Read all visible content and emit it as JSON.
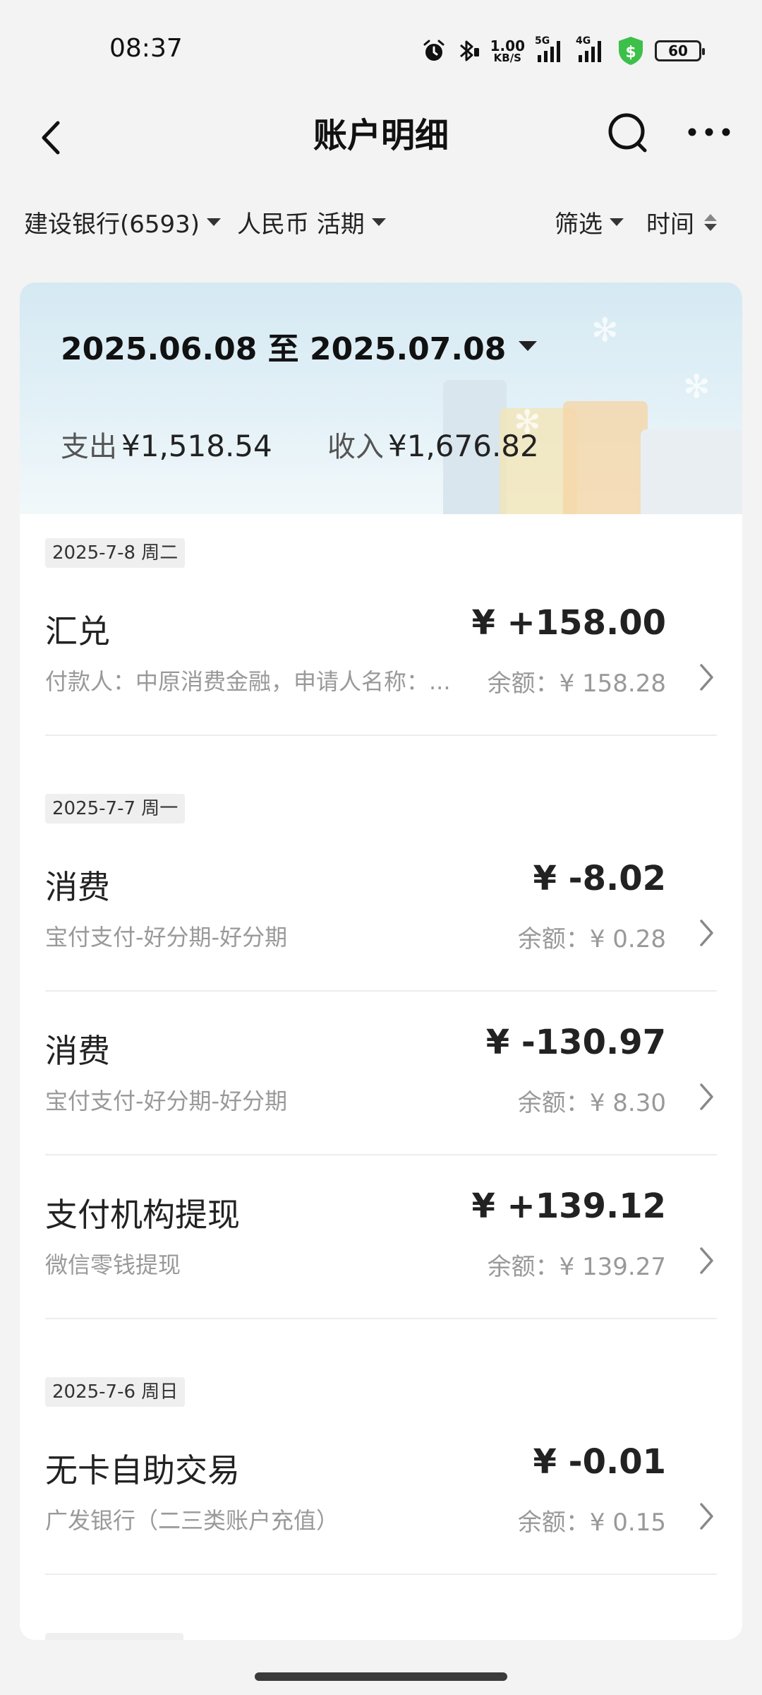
{
  "status_bar": {
    "time": "08:37",
    "speed_value": "1.00",
    "speed_unit": "KB/S",
    "sig1": "5G",
    "sig2": "4G",
    "battery": "60",
    "icons": [
      "alarm-icon",
      "bluetooth-icon",
      "network-speed",
      "signal-5g-icon",
      "signal-4g-icon",
      "security-shield-icon",
      "battery-icon"
    ]
  },
  "header": {
    "title": "账户明细",
    "icons": [
      "back-icon",
      "search-icon",
      "more-icon"
    ]
  },
  "filters": {
    "account": "建设银行(6593)",
    "currency": "人民币 活期",
    "filter": "筛选",
    "sort": "时间"
  },
  "summary": {
    "period": "2025.06.08 至 2025.07.08",
    "expense_label": "支出",
    "expense_value": "¥1,518.54",
    "income_label": "收入",
    "income_value": "¥1,676.82"
  },
  "groups": [
    {
      "date": "2025-7-8 周二",
      "items": [
        {
          "name": "汇兑",
          "amount": "¥ +158.00",
          "desc": "付款人：中原消费金融，申请人名称：...",
          "balance": "余额：¥ 158.28"
        }
      ]
    },
    {
      "date": "2025-7-7 周一",
      "items": [
        {
          "name": "消费",
          "amount": "¥ -8.02",
          "desc": "宝付支付-好分期-好分期",
          "balance": "余额：¥ 0.28"
        },
        {
          "name": "消费",
          "amount": "¥ -130.97",
          "desc": "宝付支付-好分期-好分期",
          "balance": "余额：¥ 8.30"
        },
        {
          "name": "支付机构提现",
          "amount": "¥ +139.12",
          "desc": "微信零钱提现",
          "balance": "余额：¥ 139.27"
        }
      ]
    },
    {
      "date": "2025-7-6 周日",
      "items": [
        {
          "name": "无卡自助交易",
          "amount": "¥ -0.01",
          "desc": "广发银行（二三类账户充值）",
          "balance": "余额：¥ 0.15"
        }
      ]
    }
  ],
  "colors": {
    "background": "#f3f3f3",
    "card": "#ffffff",
    "text_primary": "#222222",
    "text_secondary": "#999999",
    "shield_green": "#3cc04a"
  }
}
